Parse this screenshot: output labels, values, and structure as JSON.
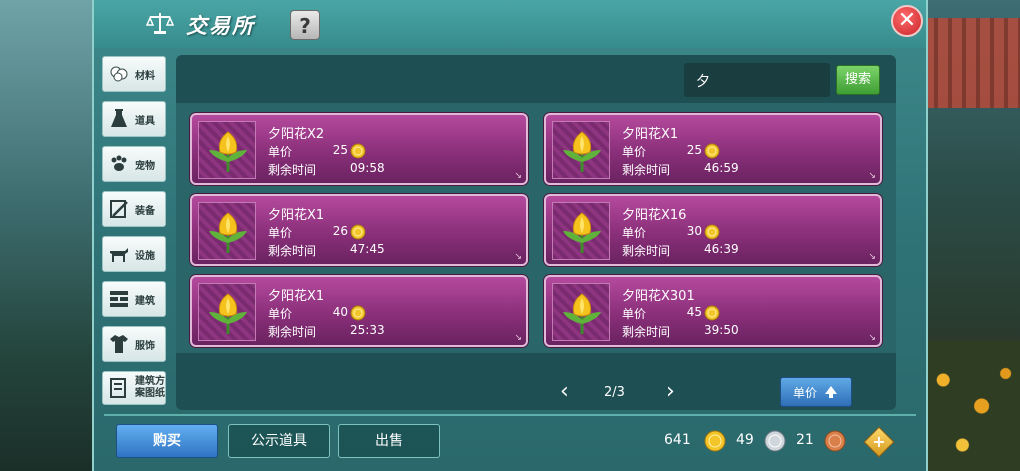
{
  "header": {
    "title": "交易所",
    "help_label": "?",
    "close_label": "✕"
  },
  "sidebar": {
    "items": [
      {
        "label": "材料",
        "icon": "cotton-icon"
      },
      {
        "label": "道具",
        "icon": "flask-icon"
      },
      {
        "label": "宠物",
        "icon": "paw-icon"
      },
      {
        "label": "装备",
        "icon": "sword-icon"
      },
      {
        "label": "设施",
        "icon": "horse-icon"
      },
      {
        "label": "建筑",
        "icon": "brick-icon"
      },
      {
        "label": "服饰",
        "icon": "shirt-icon"
      },
      {
        "label": "建筑方案图纸",
        "icon": "blueprint-icon"
      }
    ]
  },
  "search": {
    "value": "夕",
    "button_label": "搜索"
  },
  "listings": [
    {
      "name": "夕阳花X2",
      "price_label": "单价",
      "price": "25",
      "time_label": "剩余时间",
      "time": "09:58"
    },
    {
      "name": "夕阳花X1",
      "price_label": "单价",
      "price": "25",
      "time_label": "剩余时间",
      "time": "46:59"
    },
    {
      "name": "夕阳花X1",
      "price_label": "单价",
      "price": "26",
      "time_label": "剩余时间",
      "time": "47:45"
    },
    {
      "name": "夕阳花X16",
      "price_label": "单价",
      "price": "30",
      "time_label": "剩余时间",
      "time": "46:39"
    },
    {
      "name": "夕阳花X1",
      "price_label": "单价",
      "price": "40",
      "time_label": "剩余时间",
      "time": "25:33"
    },
    {
      "name": "夕阳花X301",
      "price_label": "单价",
      "price": "45",
      "time_label": "剩余时间",
      "time": "39:50"
    }
  ],
  "pager": {
    "prev": "‹",
    "text": "2/3",
    "next": "›"
  },
  "sort": {
    "label": "单价"
  },
  "tabs": {
    "buy": "购买",
    "public": "公示道具",
    "sell": "出售"
  },
  "currency": {
    "gold": "641",
    "silver": "49",
    "copper": "21",
    "add": "+"
  },
  "colors": {
    "card": "#8a2f7a",
    "panel": "#2f7377",
    "buy_tab": "#2f74c4",
    "search_btn": "#3f9e33"
  }
}
